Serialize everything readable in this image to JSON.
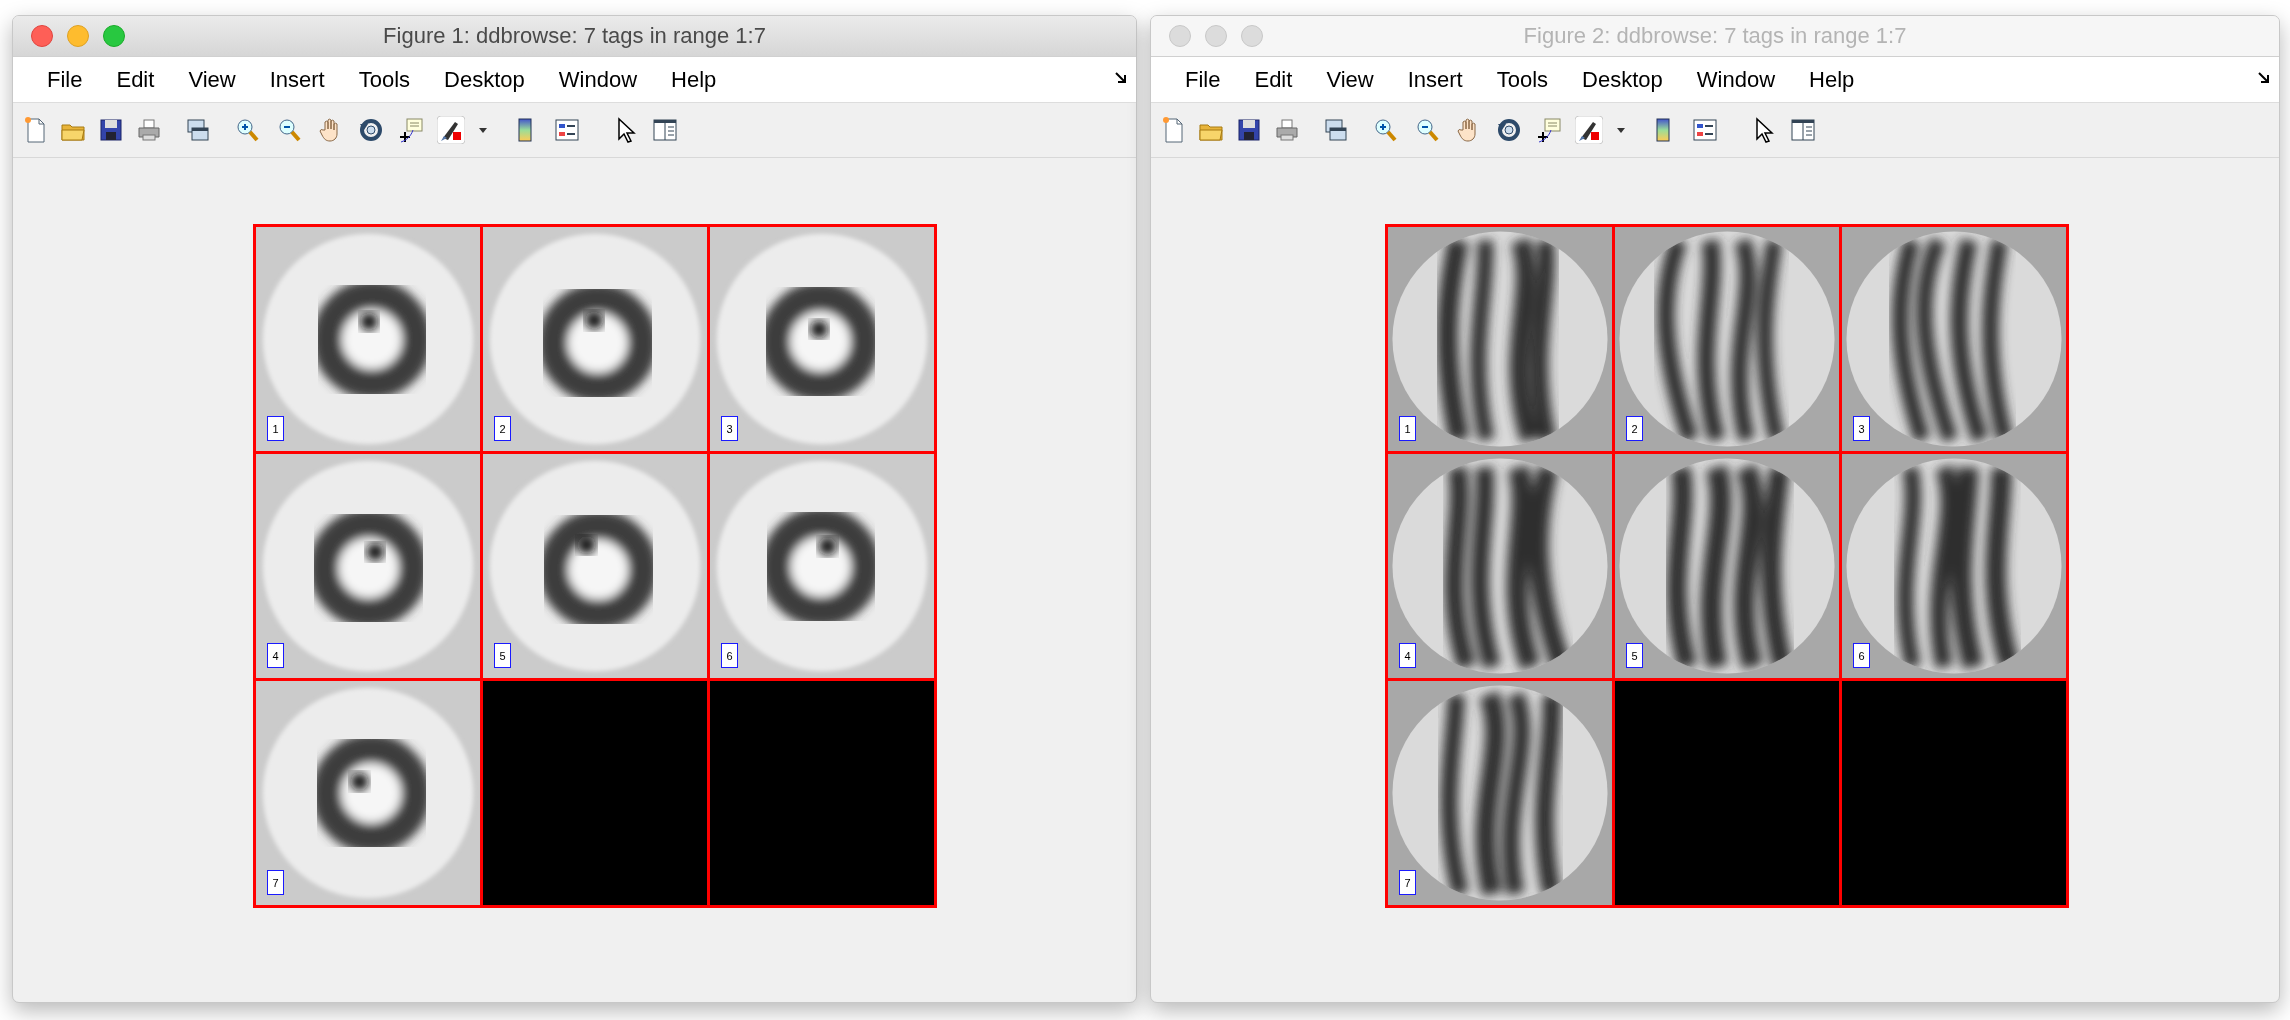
{
  "windows": [
    {
      "title": "Figure 1: ddbrowse: 7 tags in range 1:7",
      "active": true,
      "menu": [
        "File",
        "Edit",
        "View",
        "Insert",
        "Tools",
        "Desktop",
        "Window",
        "Help"
      ],
      "tiles": [
        {
          "label": "1",
          "kind": "ring"
        },
        {
          "label": "2",
          "kind": "ring"
        },
        {
          "label": "3",
          "kind": "ring"
        },
        {
          "label": "4",
          "kind": "ring"
        },
        {
          "label": "5",
          "kind": "ring"
        },
        {
          "label": "6",
          "kind": "ring"
        },
        {
          "label": "7",
          "kind": "ring"
        },
        {
          "kind": "empty"
        },
        {
          "kind": "empty"
        }
      ]
    },
    {
      "title": "Figure 2: ddbrowse: 7 tags in range 1:7",
      "active": false,
      "menu": [
        "File",
        "Edit",
        "View",
        "Insert",
        "Tools",
        "Desktop",
        "Window",
        "Help"
      ],
      "tiles": [
        {
          "label": "1",
          "kind": "filament"
        },
        {
          "label": "2",
          "kind": "filament"
        },
        {
          "label": "3",
          "kind": "filament"
        },
        {
          "label": "4",
          "kind": "filament"
        },
        {
          "label": "5",
          "kind": "filament"
        },
        {
          "label": "6",
          "kind": "filament"
        },
        {
          "label": "7",
          "kind": "filament"
        },
        {
          "kind": "empty"
        },
        {
          "kind": "empty"
        }
      ]
    }
  ]
}
